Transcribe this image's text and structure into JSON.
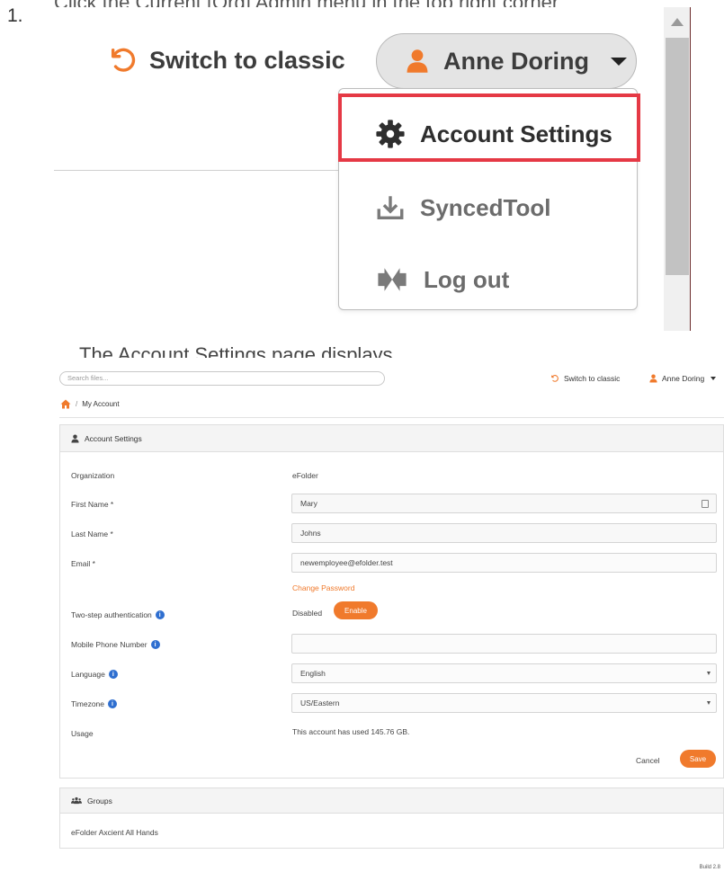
{
  "step": {
    "number": "1.",
    "instruction_clipped": "Click the Current [Org] Admin menu in the top right corner"
  },
  "zoom": {
    "switch_classic_label": "Switch to classic",
    "user_name": "Anne Doring",
    "menu_items": [
      {
        "label": "Account Settings",
        "icon": "gear-icon"
      },
      {
        "label": "SyncedTool",
        "icon": "download-icon"
      },
      {
        "label": "Log out",
        "icon": "logout-icon"
      }
    ]
  },
  "caption_clipped": "The Account Settings page displays.",
  "app": {
    "search_placeholder": "Search files...",
    "switch_classic_label": "Switch to classic",
    "user_name": "Anne Doring",
    "breadcrumb": {
      "current": "My Account"
    },
    "account_panel": {
      "title": "Account Settings",
      "organization_label": "Organization",
      "organization_value": "eFolder",
      "first_name_label": "First Name *",
      "first_name_value": "Mary",
      "last_name_label": "Last Name *",
      "last_name_value": "Johns",
      "email_label": "Email *",
      "email_value": "newemployee@efolder.test",
      "change_password_label": "Change Password",
      "two_step_label": "Two-step authentication",
      "two_step_status": "Disabled",
      "enable_label": "Enable",
      "mobile_label": "Mobile Phone Number",
      "mobile_value": "",
      "language_label": "Language",
      "language_value": "English",
      "timezone_label": "Timezone",
      "timezone_value": "US/Eastern",
      "usage_label": "Usage",
      "usage_value": "This account has used 145.76 GB.",
      "cancel_label": "Cancel",
      "save_label": "Save"
    },
    "groups_panel": {
      "title": "Groups",
      "items": [
        "eFolder Axcient All Hands"
      ]
    },
    "build_label": "Build 2.8"
  },
  "colors": {
    "accent": "#f07a2c",
    "highlight": "#e53945",
    "info": "#2f6fd0"
  }
}
